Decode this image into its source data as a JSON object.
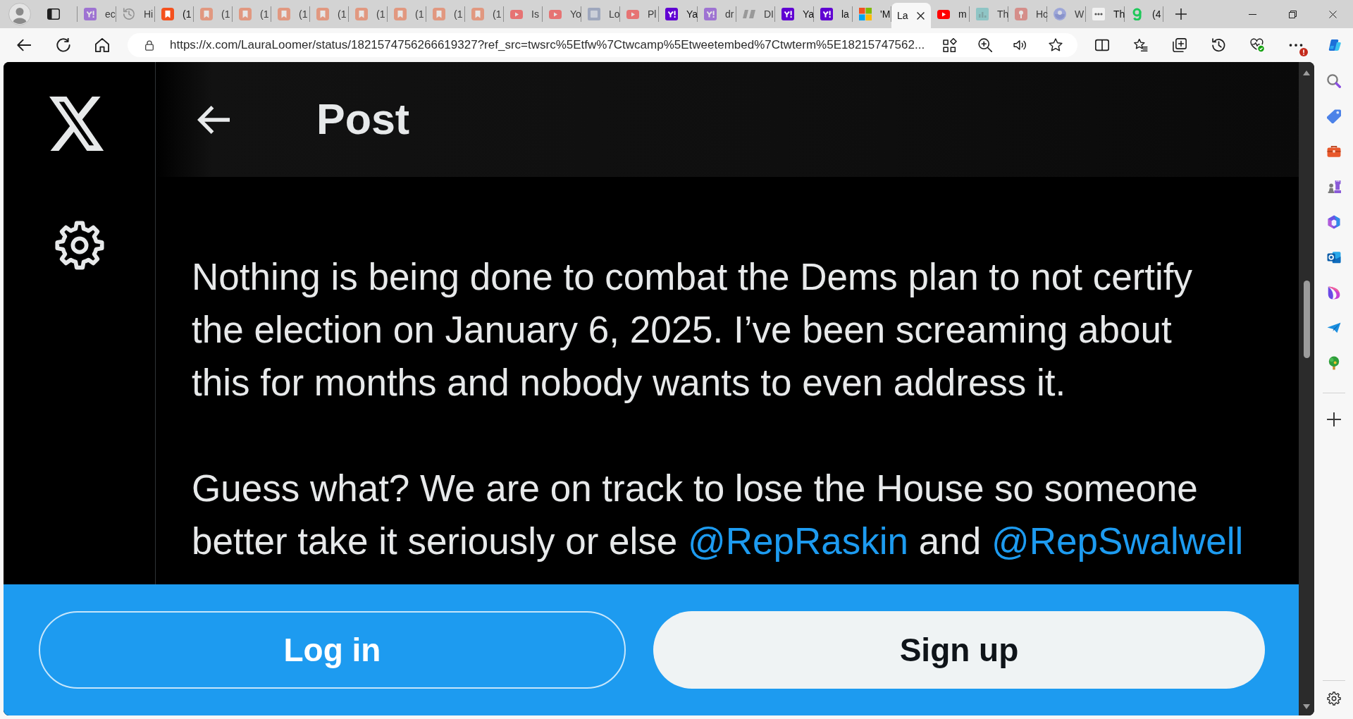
{
  "tabs": [
    {
      "kind": "tile",
      "title": "ec",
      "dimmed": true,
      "selected": false
    },
    {
      "kind": "history",
      "title": "Hi",
      "dimmed": true,
      "selected": false
    },
    {
      "kind": "bookmark",
      "title": "(1",
      "dimmed": false,
      "selected": false
    },
    {
      "kind": "bookmark",
      "title": "(1",
      "dimmed": true,
      "selected": false
    },
    {
      "kind": "bookmark",
      "title": "(1",
      "dimmed": true,
      "selected": false
    },
    {
      "kind": "bookmark",
      "title": "(1",
      "dimmed": true,
      "selected": false
    },
    {
      "kind": "bookmark",
      "title": "(1",
      "dimmed": true,
      "selected": false
    },
    {
      "kind": "bookmark",
      "title": "(1",
      "dimmed": true,
      "selected": false
    },
    {
      "kind": "bookmark",
      "title": "(1",
      "dimmed": true,
      "selected": false
    },
    {
      "kind": "bookmark",
      "title": "(1",
      "dimmed": true,
      "selected": false
    },
    {
      "kind": "bookmark",
      "title": "(1",
      "dimmed": true,
      "selected": false
    },
    {
      "kind": "play",
      "title": "Is",
      "dimmed": true,
      "selected": false
    },
    {
      "kind": "play",
      "title": "Yo",
      "dimmed": true,
      "selected": false
    },
    {
      "kind": "letter",
      "title": "Lo",
      "dimmed": true,
      "selected": false
    },
    {
      "kind": "play",
      "title": "Pl",
      "dimmed": true,
      "selected": false
    },
    {
      "kind": "tile",
      "title": "Ya",
      "dimmed": false,
      "selected": false
    },
    {
      "kind": "tile",
      "title": "dr",
      "dimmed": true,
      "selected": false
    },
    {
      "kind": "slant",
      "title": "DI",
      "dimmed": true,
      "selected": false
    },
    {
      "kind": "tile",
      "title": "Ya",
      "dimmed": false,
      "selected": false
    },
    {
      "kind": "tile",
      "title": "la",
      "dimmed": false,
      "selected": false
    },
    {
      "kind": "squares",
      "title": "'M",
      "dimmed": false,
      "selected": false
    },
    {
      "kind": "none",
      "title": "La",
      "dimmed": false,
      "selected": true
    },
    {
      "kind": "play",
      "title": "m",
      "dimmed": false,
      "selected": false
    },
    {
      "kind": "chart",
      "title": "Th",
      "dimmed": true,
      "selected": false
    },
    {
      "kind": "figure",
      "title": "Hc",
      "dimmed": true,
      "selected": false
    },
    {
      "kind": "globe",
      "title": "W",
      "dimmed": true,
      "selected": false
    },
    {
      "kind": "dots",
      "title": "Th",
      "dimmed": false,
      "selected": false
    },
    {
      "kind": "hook",
      "title": "(4",
      "dimmed": false,
      "selected": false
    }
  ],
  "address_bar": {
    "url": "https://x.com/LauraLoomer/status/1821574756266619327?ref_src=twsrc%5Etfw%7Ctwcamp%5Etweetembed%7Ctwterm%5E18215747562..."
  },
  "more_button": {
    "alert": true
  },
  "header": {
    "title": "Post"
  },
  "post": {
    "paragraphs": [
      {
        "lines": [
          [
            {
              "kind": "text",
              "text": "Nothing is being done to combat the Dems plan to not certify"
            }
          ],
          [
            {
              "kind": "text",
              "text": "the election on January 6, 2025. I’ve been screaming about"
            }
          ],
          [
            {
              "kind": "text",
              "text": "this for months and nobody wants to even address it."
            }
          ]
        ]
      },
      {
        "lines": [
          [
            {
              "kind": "text",
              "text": "Guess what? We are on track to lose the House so someone"
            }
          ],
          [
            {
              "kind": "text",
              "text": "better take it seriously or else "
            },
            {
              "kind": "mention",
              "text": "@RepRaskin"
            },
            {
              "kind": "text",
              "text": " and "
            },
            {
              "kind": "mention",
              "text": "@RepSwalwell"
            }
          ]
        ]
      }
    ]
  },
  "signup_bar": {
    "buttons": [
      {
        "kind": "outline",
        "label": "Log in"
      },
      {
        "kind": "filled",
        "label": "Sign up"
      }
    ]
  }
}
